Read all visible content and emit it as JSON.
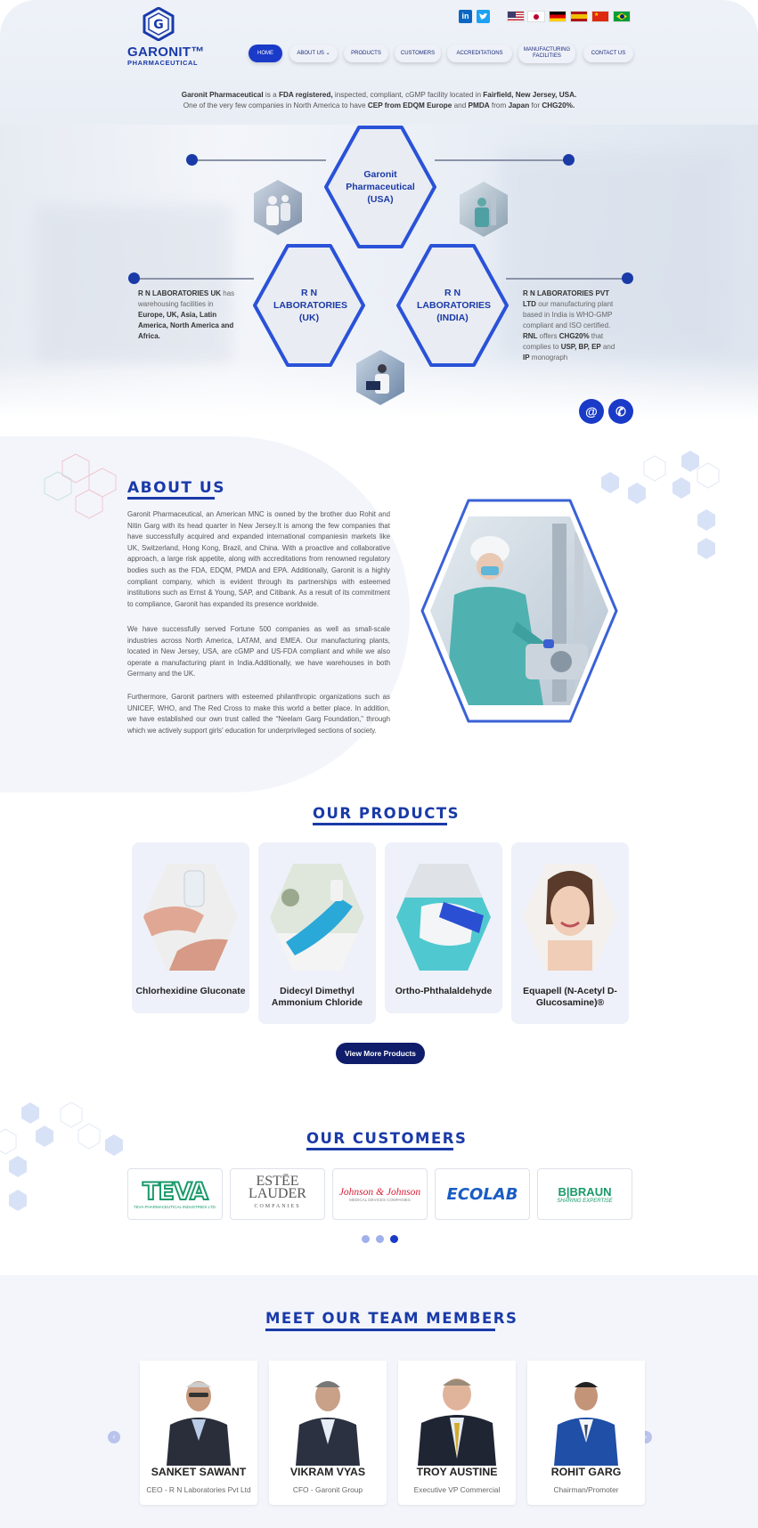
{
  "brand": {
    "name": "GARONIT™",
    "sub": "PHARMACEUTICAL"
  },
  "social": [
    {
      "name": "linkedin-icon",
      "label": "in"
    },
    {
      "name": "twitter-icon",
      "label": "t"
    }
  ],
  "languages": [
    "English",
    "Japanese",
    "German",
    "Spanish",
    "Chinese",
    "Portuguese"
  ],
  "nav": [
    {
      "label": "HOME"
    },
    {
      "label": "ABOUT US ⌄"
    },
    {
      "label": "PRODUCTS"
    },
    {
      "label": "CUSTOMERS"
    },
    {
      "label": "ACCREDITATIONS"
    },
    {
      "label": "MANUFACTURING FACILITIES"
    },
    {
      "label": "CONTACT US"
    }
  ],
  "intro": {
    "line1_a": "Garonit Pharmaceutical",
    "line1_b": " is a ",
    "line1_c": "FDA registered,",
    "line1_d": " inspected, compliant, cGMP facility located in ",
    "line1_e": "Fairfield, New Jersey, USA.",
    "line2_a": "One of the very few companies in North America to have ",
    "line2_b": "CEP from EDQM Europe",
    "line2_c": " and ",
    "line2_d": "PMDA",
    "line2_e": " from ",
    "line2_f": "Japan",
    "line2_g": " for ",
    "line2_h": "CHG20%."
  },
  "hubs": {
    "usa": "Garonit Pharmaceutical (USA)",
    "uk": "R N LABORATORIES (UK)",
    "india": "R N LABORATORIES (INDIA)"
  },
  "uk_text": {
    "a": "R N LABORATORIES UK",
    "b": " has warehousing facilities in ",
    "c": "Europe, UK, Asia, Latin America, North America and Africa."
  },
  "india_text": {
    "a": "R N LABORATORIES PVT LTD",
    "b": " our manufacturing plant based in India is WHO-GMP compliant and ISO certified. ",
    "c": "RNL",
    "d": " offers ",
    "e": "CHG20%",
    "f": " that complies to ",
    "g": "USP, BP, EP",
    "h": " and ",
    "i": "IP",
    "j": " monograph"
  },
  "fab": {
    "email": "@",
    "phone": "✆"
  },
  "about": {
    "title": "ABOUT US",
    "p1": "Garonit Pharmaceutical, an American MNC is owned by the brother duo Rohit and Nitin Garg with its head quarter in New Jersey.It is among the few companies that have successfully acquired and expanded international companiesin markets like UK, Switzerland, Hong Kong, Brazil, and China. With a proactive and collaborative approach, a large risk appetite, along with accreditations from renowned regulatory bodies such as the FDA, EDQM, PMDA and EPA. Additionally, Garonit is a highly compliant company, which is evident through its partnerships with esteemed institutions such as Ernst & Young, SAP, and Citibank. As a result of its commitment to compliance, Garonit has expanded its presence worldwide.",
    "p2": "We have successfully served Fortune 500 companies as well as small-scale industries across North America, LATAM, and EMEA. Our manufacturing plants, located in New Jersey, USA, are cGMP and US-FDA compliant and while we also operate a manufacturing plant in India.Additionally, we have warehouses in both Germany and the UK.",
    "p3": "Furthermore, Garonit partners with esteemed philanthropic organizations such as UNICEF, WHO, and The Red Cross to make this world a better place. In addition, we have established our own trust called the “Neelam Garg Foundation,” through which we actively support girls' education for underprivileged sections of society."
  },
  "products": {
    "title": "OUR PRODUCTS",
    "items": [
      {
        "name": "Chlorhexidine Gluconate"
      },
      {
        "name": "Didecyl Dimethyl Ammonium Chloride"
      },
      {
        "name": "Ortho-Phthalaldehyde"
      },
      {
        "name": "Equapell (N-Acetyl D-Glucosamine)®"
      }
    ],
    "more": "View More Products"
  },
  "customers": {
    "title": "OUR CUSTOMERS",
    "logos": [
      {
        "mark": "TEVA",
        "sub": "TEVA PHARMACEUTICAL INDUSTRIES LTD."
      },
      {
        "mark": "ESTĒE LAUDER",
        "sub": "COMPANIES"
      },
      {
        "mark": "Johnson & Johnson",
        "sub": "MEDICAL DEVICES COMPANIES"
      },
      {
        "mark": "ECOLAB",
        "sub": ""
      },
      {
        "mark": "B|BRAUN",
        "sub": "SHARING EXPERTISE"
      }
    ],
    "active_page": 3
  },
  "team": {
    "title": "MEET OUR TEAM MEMBERS",
    "members": [
      {
        "name": "SANKET SAWANT",
        "role": "CEO - R N Laboratories Pvt Ltd"
      },
      {
        "name": "VIKRAM VYAS",
        "role": "CFO - Garonit Group"
      },
      {
        "name": "TROY AUSTINE",
        "role": "Executive VP Commercial"
      },
      {
        "name": "ROHIT GARG",
        "role": "Chairman/Promoter"
      }
    ],
    "prev": "‹",
    "next": "›"
  },
  "colors": {
    "brand": "#1a3aa8",
    "button_dark": "#0f1d6a",
    "nav_active": "#1a3ac8",
    "card_bg": "#eef1f9"
  }
}
